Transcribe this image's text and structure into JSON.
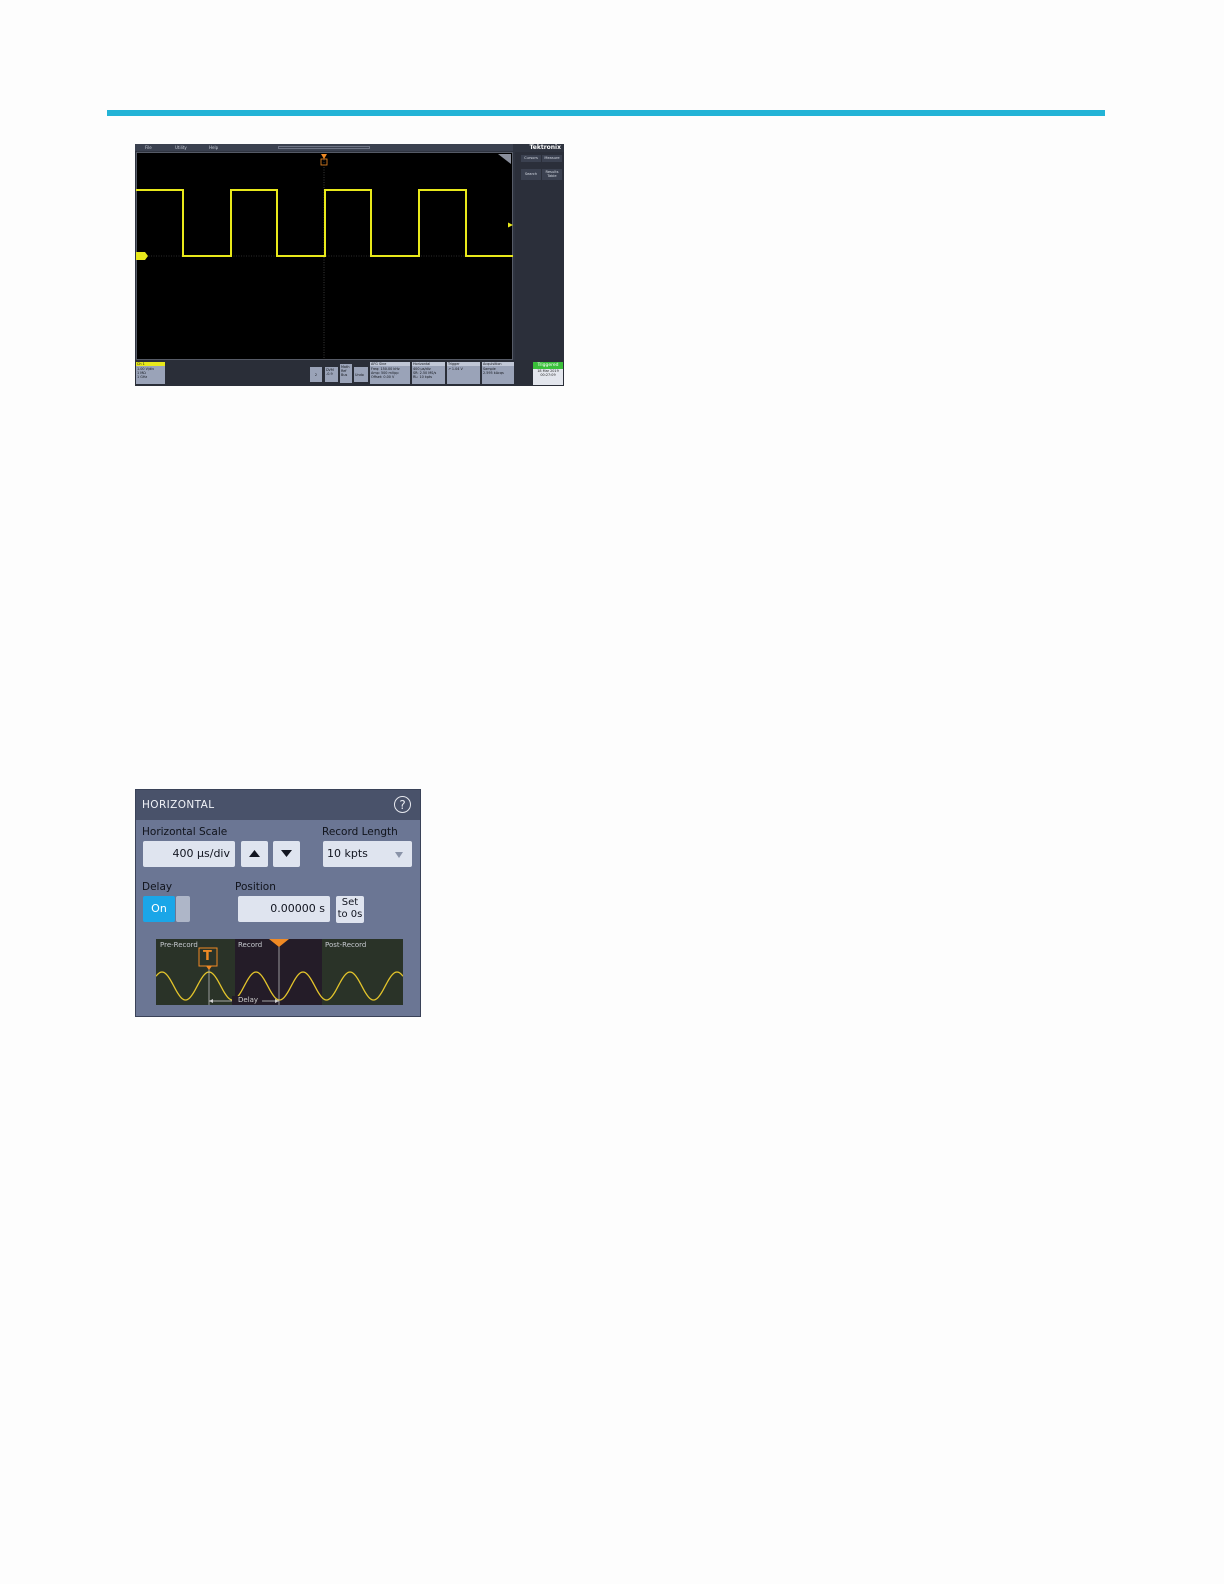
{
  "scope": {
    "menu": [
      "File",
      "Utility",
      "Help"
    ],
    "brand": "Tektronix",
    "side_buttons": [
      "Cursors",
      "Measure",
      "Search",
      "Results Table"
    ],
    "channel_badge": {
      "title": "Ch 1",
      "lines": [
        "1.00 V/div",
        "1 MΩ",
        "1 GHz"
      ]
    },
    "small_badges": [
      "2",
      "DVM -0.9",
      "Math Ref Bus",
      "Undo"
    ],
    "afg_badge": {
      "title": "AFG Sine",
      "lines": [
        "Freq: 150.00 kHz",
        "Amp: 500 mVpp",
        "Offset: 0.00 V"
      ]
    },
    "horizontal_badge": {
      "title": "Horizontal",
      "lines": [
        "400 µs/div",
        "SR: 2.50 MS/s",
        "RL: 10 kpts"
      ]
    },
    "trigger_badge": {
      "title": "Trigger",
      "lines": [
        "↗ 1.04 V"
      ]
    },
    "acquisition_badge": {
      "title": "Acquisition",
      "lines": [
        "Sample",
        "2.595 kAcqs"
      ]
    },
    "status": {
      "label": "Triggered",
      "date": "18 Mar 2019",
      "time": "00:27:09"
    }
  },
  "horizontal": {
    "title": "HORIZONTAL",
    "help_icon": "?",
    "scale_label": "Horizontal Scale",
    "scale_value": "400 µs/div",
    "record_length_label": "Record Length",
    "record_length_value": "10 kpts",
    "delay_label": "Delay",
    "delay_toggle": "On",
    "position_label": "Position",
    "position_value": "0.00000 s",
    "set_zero_label": "Set to 0s",
    "diagram": {
      "pre_record": "Pre-Record",
      "record": "Record",
      "post_record": "Post-Record",
      "trigger_marker": "T",
      "delay": "Delay"
    }
  },
  "colors": {
    "accent_rule": "#23b3d6",
    "trace": "#e8e81a",
    "toggle_on": "#1aa6e8",
    "triggered": "#3ac03a",
    "marker": "#f08a24"
  }
}
